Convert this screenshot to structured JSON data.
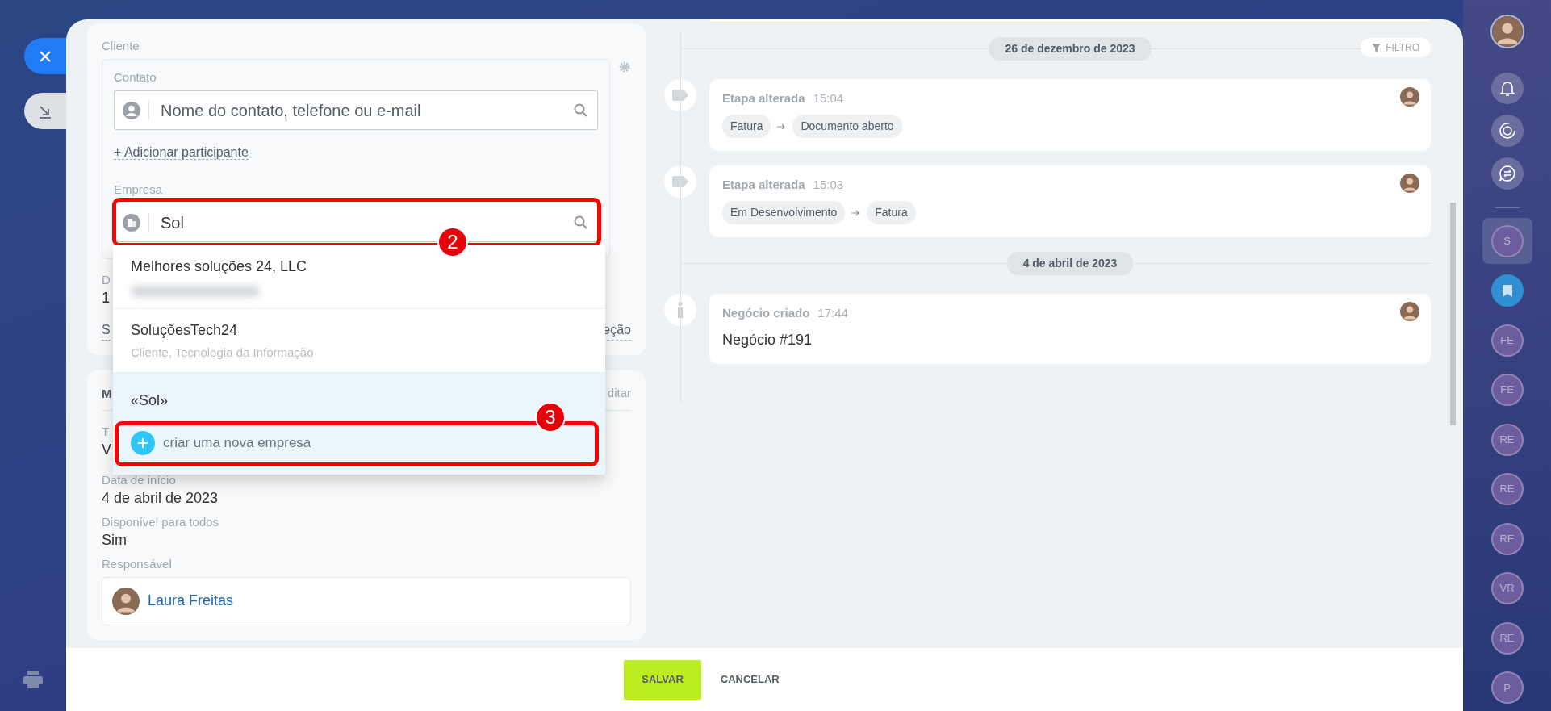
{
  "client_card": {
    "label": "Cliente",
    "contact": {
      "label": "Contato",
      "placeholder": "Nome do contato, telefone ou e-mail"
    },
    "add_participant": "+ Adicionar participante",
    "company": {
      "label": "Empresa",
      "value": "Sol",
      "annotation": "2"
    },
    "fragments": {
      "field_label": "D",
      "field_value": "1",
      "link_left": "S",
      "link_right": "eção"
    }
  },
  "dropdown": {
    "items": [
      {
        "kind": "company",
        "title": "Melhores soluções 24, LLC",
        "redacted": true
      },
      {
        "kind": "company",
        "title": "SoluçõesTech24",
        "subtitle": "Cliente, Tecnologia da Informação"
      },
      {
        "kind": "query",
        "title": "«Sol»"
      },
      {
        "kind": "create",
        "title": "criar uma nova empresa",
        "annotation": "3"
      }
    ]
  },
  "details_card": {
    "title": "M",
    "edit_link": "ditar",
    "first_field": {
      "label": "T",
      "value": "V"
    },
    "fields": [
      {
        "label": "Data de início",
        "value": "4 de abril de 2023"
      },
      {
        "label": "Disponível para todos",
        "value": "Sim"
      }
    ],
    "responsible": {
      "label": "Responsável",
      "name": "Laura Freitas"
    }
  },
  "timeline": {
    "filter": "FILTRO",
    "groups": [
      {
        "date": "26 de dezembro de 2023",
        "events": [
          {
            "kind": "stage",
            "title": "Etapa alterada",
            "time": "15:04",
            "from": "Fatura",
            "to": "Documento aberto"
          },
          {
            "kind": "stage",
            "title": "Etapa alterada",
            "time": "15:03",
            "from": "Em Desenvolvimento",
            "to": "Fatura"
          }
        ]
      },
      {
        "date": "4 de abril de 2023",
        "events": [
          {
            "kind": "info",
            "title": "Negócio criado",
            "time": "17:44",
            "text": "Negócio #191"
          }
        ]
      }
    ]
  },
  "footer": {
    "buttons": [
      {
        "kind": "primary",
        "label": "SALVAR"
      },
      {
        "kind": "link",
        "label": "CANCELAR"
      }
    ]
  },
  "right_bar": {
    "chats": [
      {
        "kind": "initials",
        "initials": "S",
        "selected": true
      },
      {
        "kind": "bookmark",
        "selected": false
      },
      {
        "kind": "initials",
        "initials": "FE",
        "selected": false
      },
      {
        "kind": "initials",
        "initials": "FE",
        "selected": false
      },
      {
        "kind": "initials",
        "initials": "RE",
        "selected": false
      },
      {
        "kind": "initials",
        "initials": "RE",
        "selected": false
      },
      {
        "kind": "initials",
        "initials": "RE",
        "selected": false
      },
      {
        "kind": "initials",
        "initials": "VR",
        "selected": false
      },
      {
        "kind": "initials",
        "initials": "RE",
        "selected": false
      },
      {
        "kind": "initials",
        "initials": "P",
        "selected": false
      }
    ]
  }
}
